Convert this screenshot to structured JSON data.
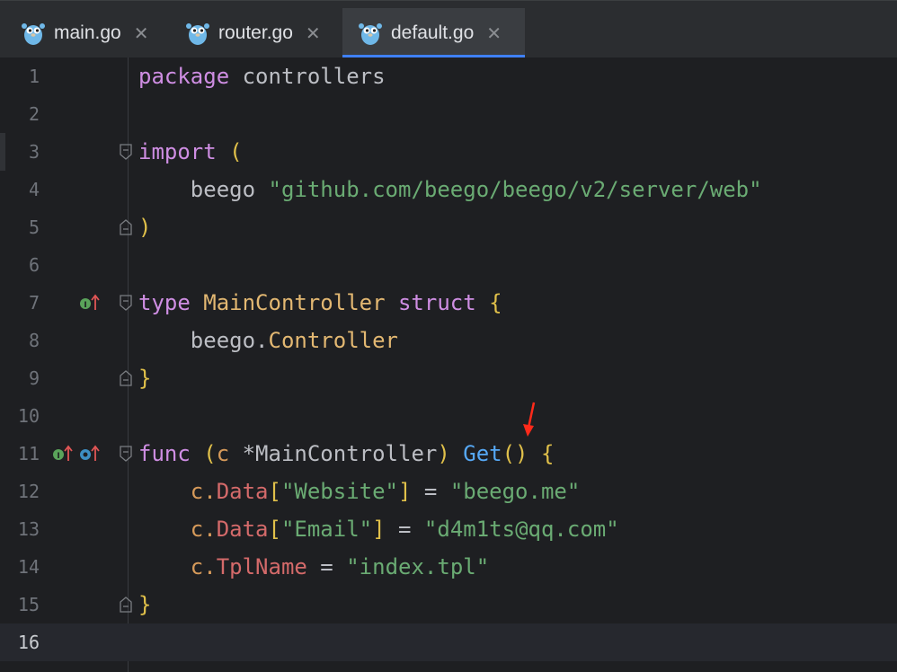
{
  "tabs": [
    {
      "label": "main.go",
      "active": false
    },
    {
      "label": "router.go",
      "active": false
    },
    {
      "label": "default.go",
      "active": true
    }
  ],
  "close_glyph": "✕",
  "line_numbers": [
    "1",
    "2",
    "3",
    "4",
    "5",
    "6",
    "7",
    "8",
    "9",
    "10",
    "11",
    "12",
    "13",
    "14",
    "15",
    "16"
  ],
  "code": {
    "l1_kw": "package",
    "l1_name": " controllers",
    "l3_kw": "import",
    "l3_paren": " (",
    "l4_pkg": "    beego ",
    "l4_str": "\"github.com/beego/beego/v2/server/web\"",
    "l5_paren": ")",
    "l7_kw": "type",
    "l7_name": " MainController ",
    "l7_kw2": "struct",
    "l7_brace": " {",
    "l8_pkg": "    beego.",
    "l8_type": "Controller",
    "l9_brace": "}",
    "l11_kw": "func",
    "l11_open": " (",
    "l11_param": "c",
    "l11_recv": " *MainController",
    "l11_close": ") ",
    "l11_fn": "Get",
    "l11_parens": "()",
    "l11_brace": " {",
    "l12_recv": "    c.",
    "l12_field": "Data",
    "l12_ob": "[",
    "l12_key": "\"Website\"",
    "l12_cb": "]",
    "l12_eq": " = ",
    "l12_val": "\"beego.me\"",
    "l13_recv": "    c.",
    "l13_field": "Data",
    "l13_ob": "[",
    "l13_key": "\"Email\"",
    "l13_cb": "]",
    "l13_eq": " = ",
    "l13_val": "\"d4m1ts@qq.com\"",
    "l14_recv": "    c.",
    "l14_field": "TplName",
    "l14_eq": " = ",
    "l14_val": "\"index.tpl\"",
    "l15_brace": "}"
  },
  "colors": {
    "accent": "#3f80f5",
    "keyword": "#cf8ee3",
    "string": "#6aab73",
    "function": "#56a8f5",
    "annotation_arrow": "#ff2a1a"
  },
  "icons": [
    "gopher-icon",
    "close-icon",
    "fold-icon",
    "implemented-icon",
    "implements-icon",
    "annotation-arrow-icon"
  ]
}
